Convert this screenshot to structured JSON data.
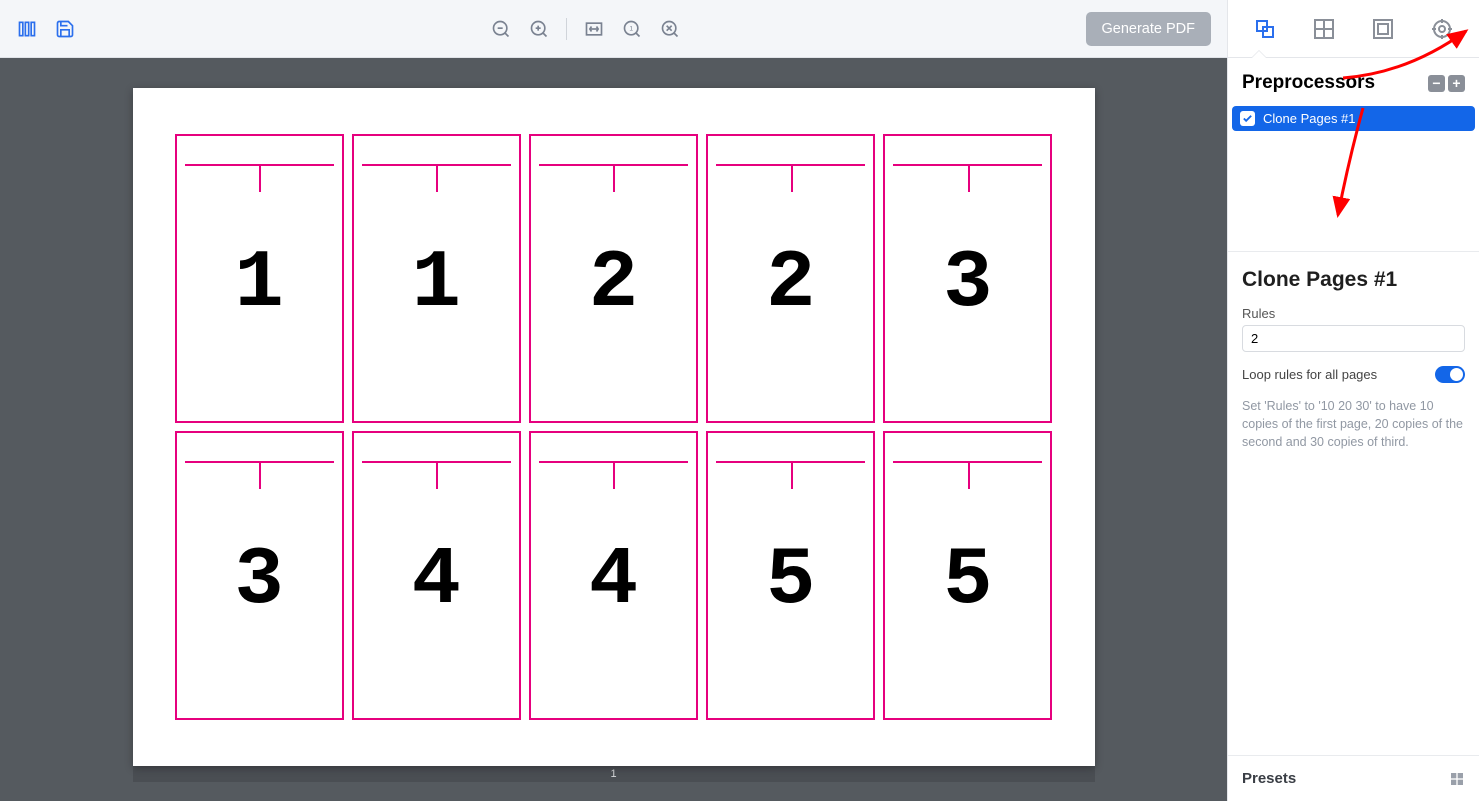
{
  "toolbar": {
    "generate_label": "Generate PDF"
  },
  "sheet": {
    "page_label": "1",
    "cards": [
      "1",
      "1",
      "2",
      "2",
      "3",
      "3",
      "4",
      "4",
      "5",
      "5"
    ]
  },
  "panel": {
    "section_title": "Preprocessors",
    "item_label": "Clone Pages #1",
    "detail_title": "Clone Pages #1",
    "rules_label": "Rules",
    "rules_value": "2",
    "loop_label": "Loop rules for all pages",
    "hint": "Set 'Rules' to '10 20 30' to have 10 copies of the first page, 20 copies of the second and 30 copies of third.",
    "presets_label": "Presets"
  }
}
